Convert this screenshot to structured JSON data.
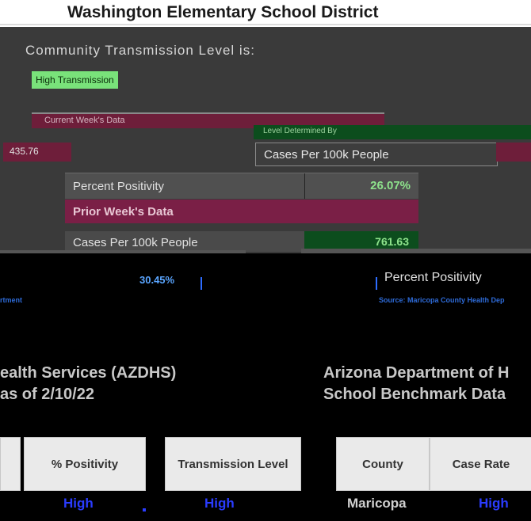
{
  "header": {
    "district": "Washington Elementary School District"
  },
  "transmission": {
    "heading": "Community Transmission Level is:",
    "badge": "High Transmission"
  },
  "current_week": {
    "label": "Current Week's Data",
    "green_label": "Level Determined By",
    "left_value": "435.76",
    "cases_label": "Cases Per 100k People",
    "percent_positivity_label": "Percent Positivity",
    "percent_positivity_value": "26.07%"
  },
  "prior_week": {
    "label": "Prior Week's Data",
    "cases_label": "Cases Per 100k People",
    "cases_value": "761.63",
    "bottom_pct": "30.45%",
    "percent_positivity_label": "Percent Positivity"
  },
  "sources": {
    "left": "rtment",
    "right": "Source: Maricopa County Health Dep"
  },
  "left_block": {
    "title_line1": "ealth Services (AZDHS)",
    "title_line2": "as of 2/10/22",
    "columns": [
      "",
      "% Positivity",
      "Transmission Level"
    ],
    "values": [
      "",
      "High",
      "High"
    ]
  },
  "right_block": {
    "title_line1": "Arizona Department of H",
    "title_line2": "School Benchmark Data",
    "columns": [
      "County",
      "Case Rate"
    ],
    "values": [
      "Maricopa",
      "High"
    ]
  },
  "colors": {
    "maroon": "#6e1e3a",
    "green": "#0c4d1d",
    "badge_green": "#79e27a",
    "link_blue": "#2a3cff"
  }
}
